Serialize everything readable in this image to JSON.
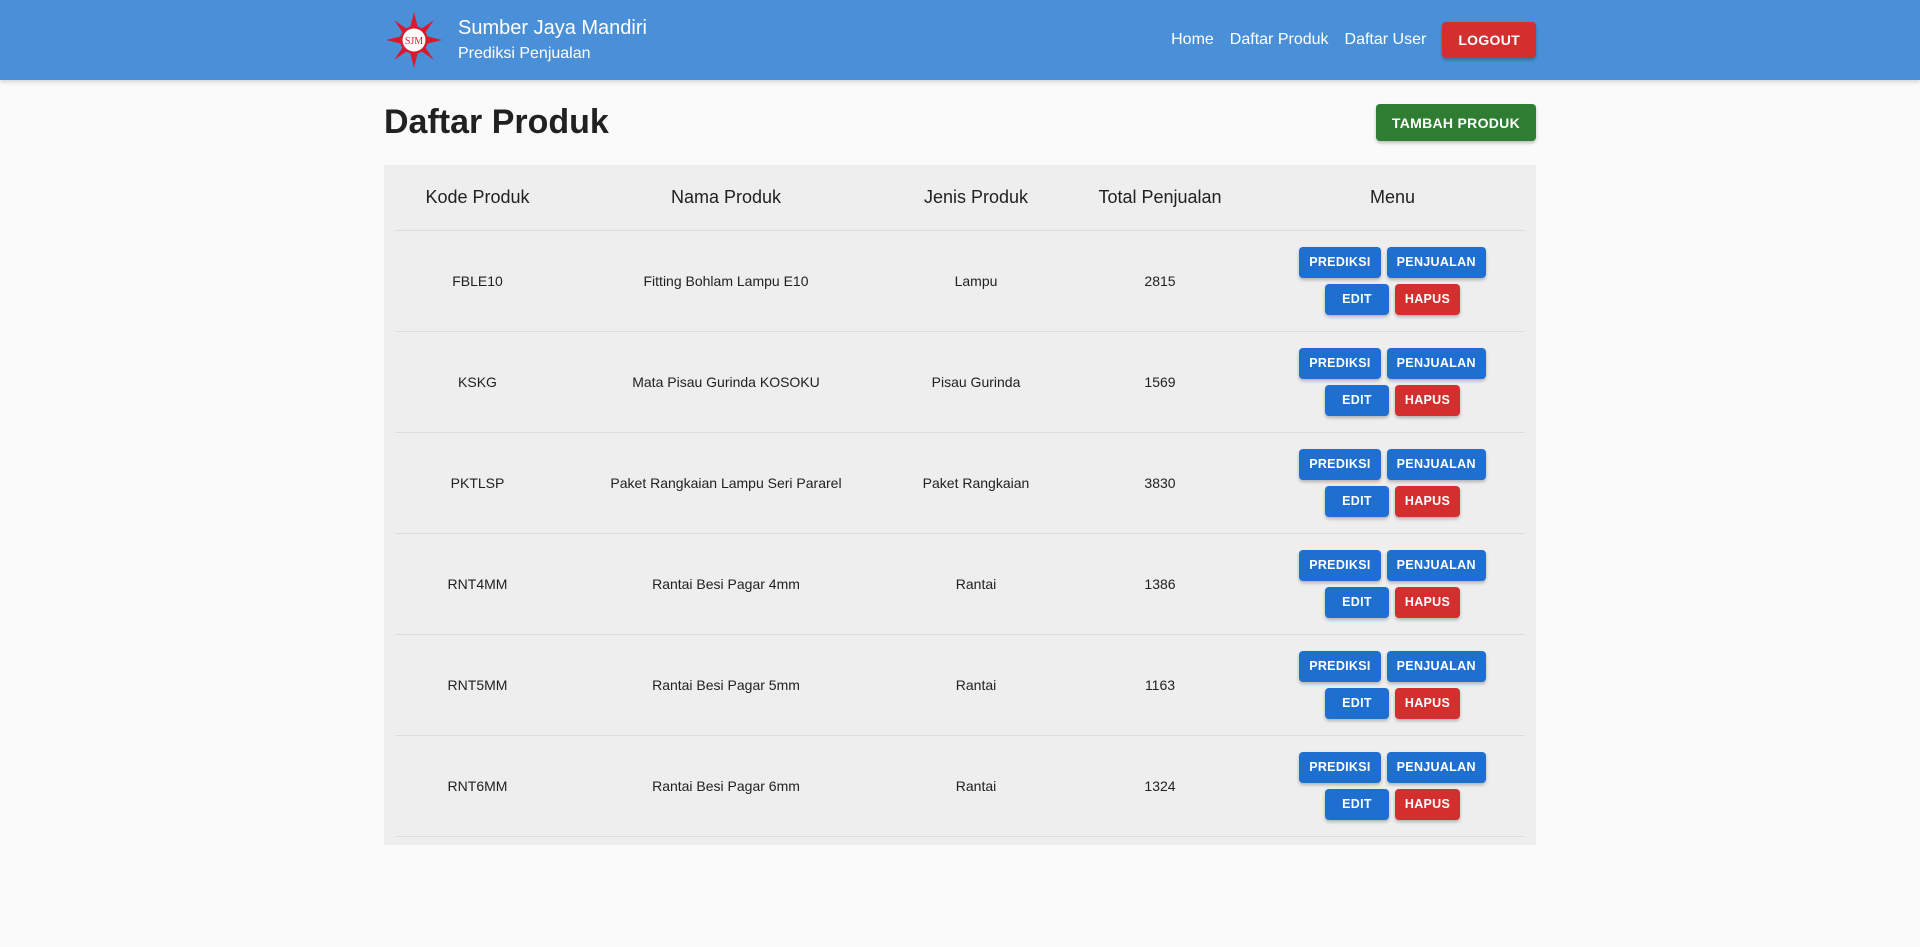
{
  "brand": {
    "title": "Sumber Jaya Mandiri",
    "subtitle": "Prediksi Penjualan",
    "logo_text": "SJM"
  },
  "nav": {
    "links": [
      "Home",
      "Daftar Produk",
      "Daftar User"
    ],
    "logout": "LOGOUT"
  },
  "page": {
    "title": "Daftar Produk",
    "add_button": "TAMBAH PRODUK"
  },
  "table": {
    "headers": [
      "Kode Produk",
      "Nama Produk",
      "Jenis Produk",
      "Total Penjualan",
      "Menu"
    ],
    "actions": {
      "prediksi": "PREDIKSI",
      "penjualan": "PENJUALAN",
      "edit": "EDIT",
      "hapus": "HAPUS"
    },
    "rows": [
      {
        "kode": "FBLE10",
        "nama": "Fitting Bohlam Lampu E10",
        "jenis": "Lampu",
        "total": "2815"
      },
      {
        "kode": "KSKG",
        "nama": "Mata Pisau Gurinda KOSOKU",
        "jenis": "Pisau Gurinda",
        "total": "1569"
      },
      {
        "kode": "PKTLSP",
        "nama": "Paket Rangkaian Lampu Seri Pararel",
        "jenis": "Paket Rangkaian",
        "total": "3830"
      },
      {
        "kode": "RNT4MM",
        "nama": "Rantai Besi Pagar 4mm",
        "jenis": "Rantai",
        "total": "1386"
      },
      {
        "kode": "RNT5MM",
        "nama": "Rantai Besi Pagar 5mm",
        "jenis": "Rantai",
        "total": "1163"
      },
      {
        "kode": "RNT6MM",
        "nama": "Rantai Besi Pagar 6mm",
        "jenis": "Rantai",
        "total": "1324"
      }
    ]
  },
  "colors": {
    "navbar": "#4a90d9",
    "primary_button": "#1e6fd0",
    "danger_button": "#d32f2f",
    "success_button": "#2e7d32"
  }
}
